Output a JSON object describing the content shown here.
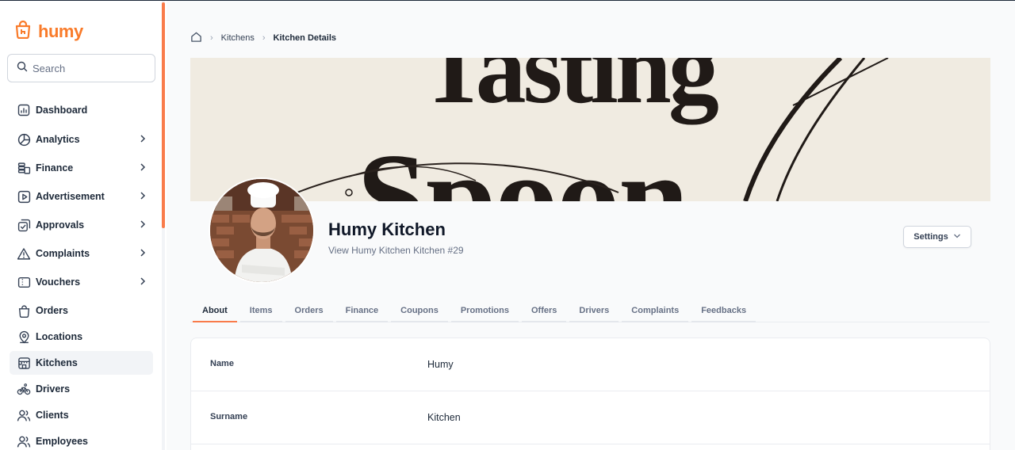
{
  "brand": {
    "name": "humy",
    "accent": "#f97b2a"
  },
  "search": {
    "placeholder": "Search"
  },
  "sidebar": {
    "items": [
      {
        "label": "Dashboard",
        "icon": "dashboard-icon",
        "has_chevron": false,
        "active": false
      },
      {
        "label": "Analytics",
        "icon": "pie-chart-icon",
        "has_chevron": true,
        "active": false
      },
      {
        "label": "Finance",
        "icon": "coins-icon",
        "has_chevron": true,
        "active": false
      },
      {
        "label": "Advertisement",
        "icon": "play-square-icon",
        "has_chevron": true,
        "active": false
      },
      {
        "label": "Approvals",
        "icon": "approval-icon",
        "has_chevron": true,
        "active": false
      },
      {
        "label": "Complaints",
        "icon": "warning-icon",
        "has_chevron": true,
        "active": false
      },
      {
        "label": "Vouchers",
        "icon": "voucher-icon",
        "has_chevron": true,
        "active": false
      },
      {
        "label": "Orders",
        "icon": "bag-icon",
        "has_chevron": false,
        "active": false
      },
      {
        "label": "Locations",
        "icon": "location-pin-icon",
        "has_chevron": false,
        "active": false
      },
      {
        "label": "Kitchens",
        "icon": "store-icon",
        "has_chevron": false,
        "active": true
      },
      {
        "label": "Drivers",
        "icon": "bicycle-icon",
        "has_chevron": false,
        "active": false
      },
      {
        "label": "Clients",
        "icon": "users-icon",
        "has_chevron": false,
        "active": false
      },
      {
        "label": "Employees",
        "icon": "employees-icon",
        "has_chevron": false,
        "active": false
      }
    ]
  },
  "breadcrumb": {
    "items": [
      "Kitchens",
      "Kitchen Details"
    ]
  },
  "banner": {
    "text_line1": "Tasting",
    "text_line2": "Spoon"
  },
  "kitchen": {
    "name": "Humy Kitchen",
    "subtitle": "View Humy Kitchen Kitchen #29"
  },
  "settings": {
    "label": "Settings"
  },
  "tabs": [
    {
      "label": "About",
      "active": true
    },
    {
      "label": "Items",
      "active": false
    },
    {
      "label": "Orders",
      "active": false
    },
    {
      "label": "Finance",
      "active": false
    },
    {
      "label": "Coupons",
      "active": false
    },
    {
      "label": "Promotions",
      "active": false
    },
    {
      "label": "Offers",
      "active": false
    },
    {
      "label": "Drivers",
      "active": false
    },
    {
      "label": "Complaints",
      "active": false
    },
    {
      "label": "Feedbacks",
      "active": false
    }
  ],
  "details": [
    {
      "label": "Name",
      "value": "Humy"
    },
    {
      "label": "Surname",
      "value": "Kitchen"
    }
  ]
}
